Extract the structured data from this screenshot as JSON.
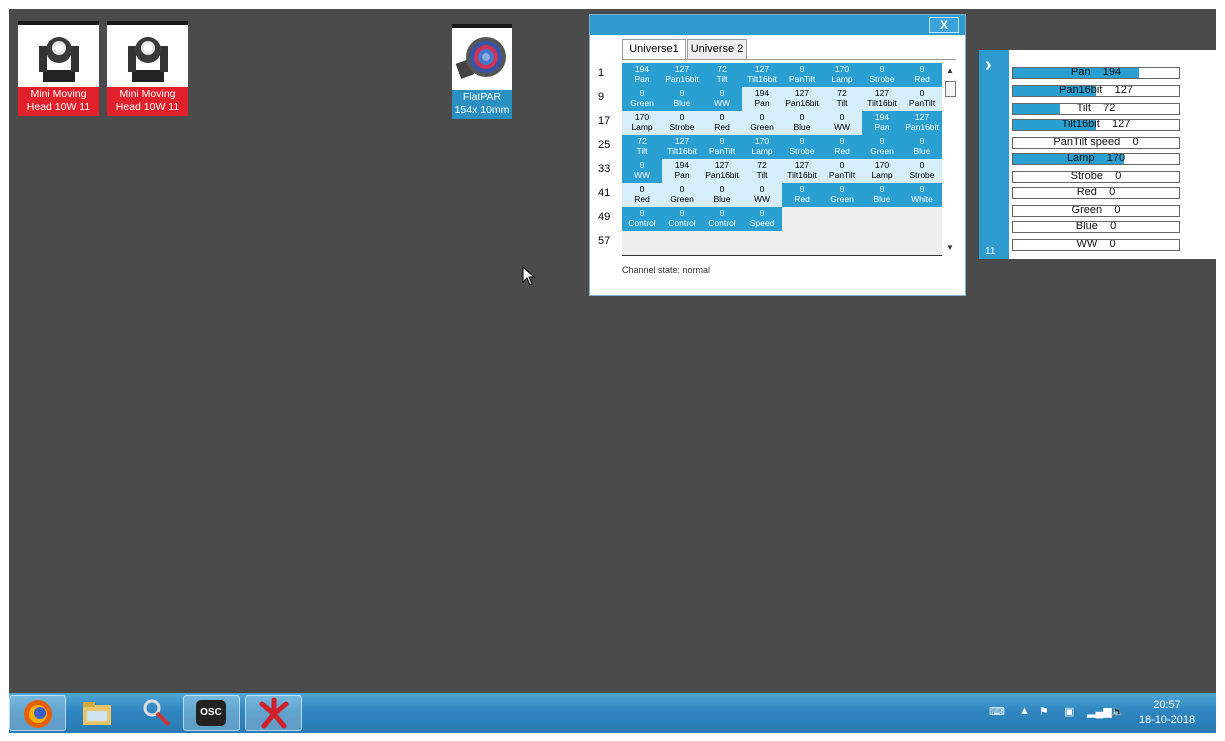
{
  "fixtures": [
    {
      "label_line1": "Mini Moving",
      "label_line2": "Head 10W 11",
      "icon": "moving-head-icon"
    },
    {
      "label_line1": "Mini Moving",
      "label_line2": "Head 10W 11",
      "icon": "moving-head-icon"
    },
    {
      "label_line1": "FlatPAR",
      "label_line2": "154x 10mm",
      "icon": "par-can-icon"
    }
  ],
  "dmx_window": {
    "close_label": "X",
    "tabs": [
      {
        "label": "Universe1",
        "active": true
      },
      {
        "label": "Universe 2",
        "active": false
      }
    ],
    "row_labels": [
      "1",
      "9",
      "17",
      "25",
      "33",
      "41",
      "49",
      "57"
    ],
    "rows": [
      [
        [
          "194",
          "Pan"
        ],
        [
          "127",
          "Pan16bit"
        ],
        [
          "72",
          "Tilt"
        ],
        [
          "127",
          "Tilt16bit"
        ],
        [
          "0",
          "PanTilt"
        ],
        [
          "170",
          "Lamp"
        ],
        [
          "0",
          "Strobe"
        ],
        [
          "0",
          "Red"
        ]
      ],
      [
        [
          "0",
          "Green"
        ],
        [
          "0",
          "Blue"
        ],
        [
          "0",
          "WW"
        ],
        [
          "194",
          "Pan"
        ],
        [
          "127",
          "Pan16bit"
        ],
        [
          "72",
          "Tilt"
        ],
        [
          "127",
          "Tilt16bit"
        ],
        [
          "0",
          "PanTilt"
        ]
      ],
      [
        [
          "170",
          "Lamp"
        ],
        [
          "0",
          "Strobe"
        ],
        [
          "0",
          "Red"
        ],
        [
          "0",
          "Green"
        ],
        [
          "0",
          "Blue"
        ],
        [
          "0",
          "WW"
        ],
        [
          "194",
          "Pan"
        ],
        [
          "127",
          "Pan16bit"
        ]
      ],
      [
        [
          "72",
          "Tilt"
        ],
        [
          "127",
          "Tilt16bit"
        ],
        [
          "0",
          "PanTilt"
        ],
        [
          "170",
          "Lamp"
        ],
        [
          "0",
          "Strobe"
        ],
        [
          "0",
          "Red"
        ],
        [
          "0",
          "Green"
        ],
        [
          "0",
          "Blue"
        ]
      ],
      [
        [
          "0",
          "WW"
        ],
        [
          "194",
          "Pan"
        ],
        [
          "127",
          "Pan16bit"
        ],
        [
          "72",
          "Tilt"
        ],
        [
          "127",
          "Tilt16bit"
        ],
        [
          "0",
          "PanTilt"
        ],
        [
          "170",
          "Lamp"
        ],
        [
          "0",
          "Strobe"
        ]
      ],
      [
        [
          "0",
          "Red"
        ],
        [
          "0",
          "Green"
        ],
        [
          "0",
          "Blue"
        ],
        [
          "0",
          "WW"
        ],
        [
          "0",
          "Red"
        ],
        [
          "0",
          "Green"
        ],
        [
          "0",
          "Blue"
        ],
        [
          "0",
          "White"
        ]
      ],
      [
        [
          "0",
          "Control"
        ],
        [
          "0",
          "Control"
        ],
        [
          "0",
          "Control"
        ],
        [
          "0",
          "Speed"
        ]
      ],
      []
    ],
    "row_shading": [
      [
        "d",
        "d",
        "d",
        "d",
        "d",
        "d",
        "d",
        "d"
      ],
      [
        "d",
        "d",
        "d",
        "l",
        "l",
        "l",
        "l",
        "l"
      ],
      [
        "l",
        "l",
        "l",
        "l",
        "l",
        "l",
        "d",
        "d"
      ],
      [
        "d",
        "d",
        "d",
        "d",
        "d",
        "d",
        "d",
        "d"
      ],
      [
        "d",
        "l",
        "l",
        "l",
        "l",
        "l",
        "l",
        "l"
      ],
      [
        "l",
        "l",
        "l",
        "l",
        "d",
        "d",
        "d",
        "d"
      ],
      [
        "d",
        "d",
        "d",
        "d"
      ],
      []
    ],
    "status_text": "Channel state: normal"
  },
  "side_panel": {
    "fixture_number": "11",
    "channels": [
      {
        "name": "Pan",
        "value": "194",
        "level": 194
      },
      {
        "name": "Pan16bit",
        "value": "127",
        "level": 127
      },
      {
        "name": "Tilt",
        "value": "72",
        "level": 72
      },
      {
        "name": "Tilt16bit",
        "value": "127",
        "level": 127
      },
      {
        "name": "PanTilt speed",
        "value": "0",
        "level": 0
      },
      {
        "name": "Lamp",
        "value": "170",
        "level": 170
      },
      {
        "name": "Strobe",
        "value": "0",
        "level": 0
      },
      {
        "name": "Red",
        "value": "0",
        "level": 0
      },
      {
        "name": "Green",
        "value": "0",
        "level": 0
      },
      {
        "name": "Blue",
        "value": "0",
        "level": 0
      },
      {
        "name": "WW",
        "value": "0",
        "level": 0
      }
    ]
  },
  "taskbar": {
    "apps": [
      "firefox-icon",
      "file-explorer-icon",
      "tool-icon",
      "osc-icon",
      "lighting-app-icon"
    ],
    "osc_label": "OSC",
    "time": "20:57",
    "date": "18-10-2018"
  },
  "colors": {
    "accent": "#2a9fd2",
    "desktop": "#4b4b4b",
    "fixture_red": "#e0202a"
  }
}
